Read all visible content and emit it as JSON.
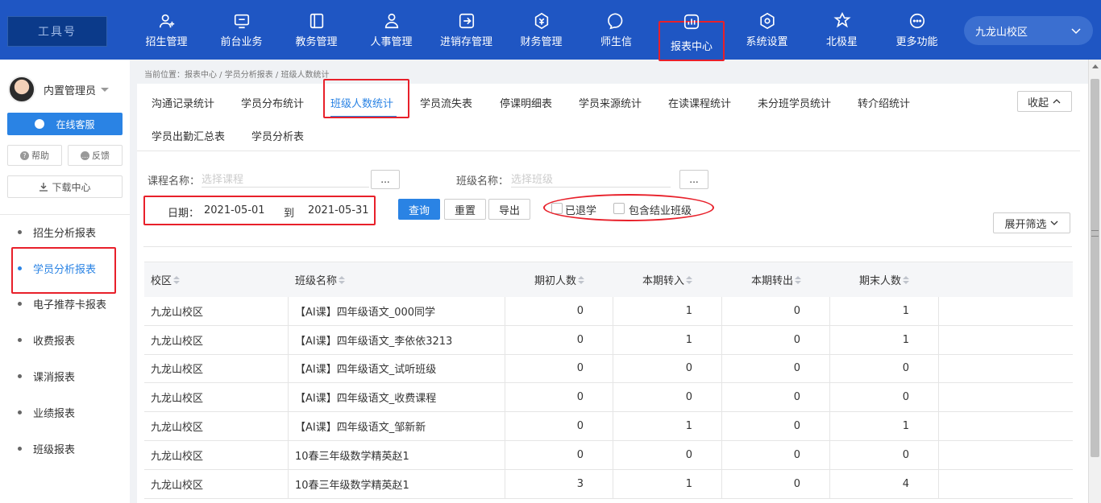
{
  "logo_text": "工具号",
  "nav": {
    "items": [
      {
        "label": "招生管理",
        "icon": "user-plus-icon"
      },
      {
        "label": "前台业务",
        "icon": "monitor-icon"
      },
      {
        "label": "教务管理",
        "icon": "book-icon"
      },
      {
        "label": "人事管理",
        "icon": "person-icon"
      },
      {
        "label": "进销存管理",
        "icon": "box-arrow-icon"
      },
      {
        "label": "财务管理",
        "icon": "money-icon"
      },
      {
        "label": "师生信",
        "icon": "chat-icon"
      },
      {
        "label": "报表中心",
        "icon": "chart-icon"
      },
      {
        "label": "系统设置",
        "icon": "settings-icon"
      },
      {
        "label": "北极星",
        "icon": "star-icon"
      },
      {
        "label": "更多功能",
        "icon": "more-icon"
      }
    ],
    "active_index": 7,
    "campus": "九龙山校区"
  },
  "sidebar": {
    "user_name": "内置管理员",
    "customer_service": "在线客服",
    "help": "帮助",
    "feedback": "反馈",
    "download": "下载中心",
    "menu": [
      "招生分析报表",
      "学员分析报表",
      "电子推荐卡报表",
      "收费报表",
      "课消报表",
      "业绩报表",
      "班级报表"
    ],
    "active_index": 1
  },
  "breadcrumb": "当前位置：报表中心 / 学员分析报表 / 班级人数统计",
  "tabs": {
    "row1": [
      "沟通记录统计",
      "学员分布统计",
      "班级人数统计",
      "学员流失表",
      "停课明细表",
      "学员来源统计",
      "在读课程统计",
      "未分班学员统计",
      "转介绍统计"
    ],
    "row2": [
      "学员出勤汇总表",
      "学员分析表"
    ],
    "active": "班级人数统计",
    "collapse": "收起"
  },
  "filters": {
    "course_label": "课程名称：",
    "course_placeholder": "选择课程",
    "class_label": "班级名称：",
    "class_placeholder": "选择班级",
    "dots": "...",
    "date_label": "日期：",
    "date_from": "2021-05-01",
    "date_to_sep": "到",
    "date_to": "2021-05-31",
    "query": "查询",
    "reset": "重置",
    "export": "导出",
    "withdrawn": "已退学",
    "include_graduated": "包含结业班级",
    "expand": "展开筛选"
  },
  "table": {
    "headers": [
      "校区",
      "班级名称",
      "期初人数",
      "本期转入",
      "本期转出",
      "期末人数"
    ],
    "rows": [
      [
        "九龙山校区",
        "【AI课】四年级语文_000同学",
        "0",
        "1",
        "0",
        "1"
      ],
      [
        "九龙山校区",
        "【AI课】四年级语文_李依依3213",
        "0",
        "1",
        "0",
        "1"
      ],
      [
        "九龙山校区",
        "【AI课】四年级语文_试听班级",
        "0",
        "0",
        "0",
        "0"
      ],
      [
        "九龙山校区",
        "【AI课】四年级语文_收费课程",
        "0",
        "0",
        "0",
        "0"
      ],
      [
        "九龙山校区",
        "【AI课】四年级语文_邹新新",
        "0",
        "1",
        "0",
        "1"
      ],
      [
        "九龙山校区",
        "10春三年级数学精英赵1",
        "0",
        "0",
        "0",
        "0"
      ],
      [
        "九龙山校区",
        "10春三年级数学精英赵1",
        "3",
        "1",
        "0",
        "4"
      ]
    ]
  },
  "colors": {
    "brand_blue": "#1f56c3",
    "accent_blue": "#2a83e4",
    "highlight_red": "#e8202a"
  }
}
